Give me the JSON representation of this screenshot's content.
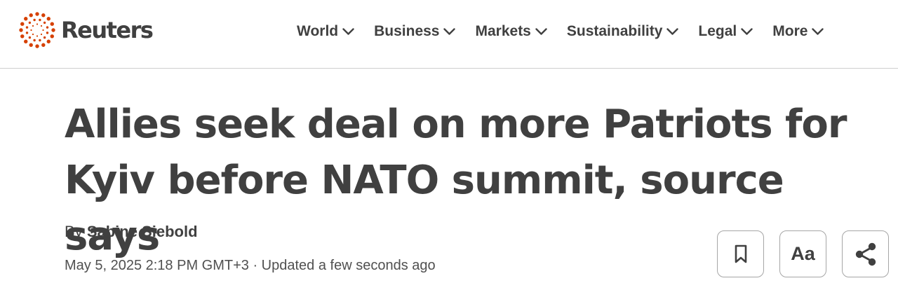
{
  "brand": {
    "name": "Reuters",
    "accent_color": "#D64000",
    "logo_icon": "reuters-dot-circle-logo"
  },
  "nav": {
    "items": [
      {
        "label": "World",
        "icon": "chevron-down-icon"
      },
      {
        "label": "Business",
        "icon": "chevron-down-icon"
      },
      {
        "label": "Markets",
        "icon": "chevron-down-icon"
      },
      {
        "label": "Sustainability",
        "icon": "chevron-down-icon"
      },
      {
        "label": "Legal",
        "icon": "chevron-down-icon"
      },
      {
        "label": "More",
        "icon": "chevron-down-icon"
      }
    ]
  },
  "article": {
    "headline": "Allies seek deal on more Patriots for Kyiv before NATO summit, source says",
    "byline_prefix": "By",
    "author": "Sabine Siebold",
    "dateline": "May 5, 2025 2:18 PM GMT+3 · Updated a few seconds ago"
  },
  "tools": {
    "save_icon": "bookmark-icon",
    "text_size_label": "Aa",
    "share_icon": "share-icon"
  },
  "colors": {
    "text": "#404040",
    "divider": "#cfcfcf",
    "button_border": "#a6a6a6"
  }
}
